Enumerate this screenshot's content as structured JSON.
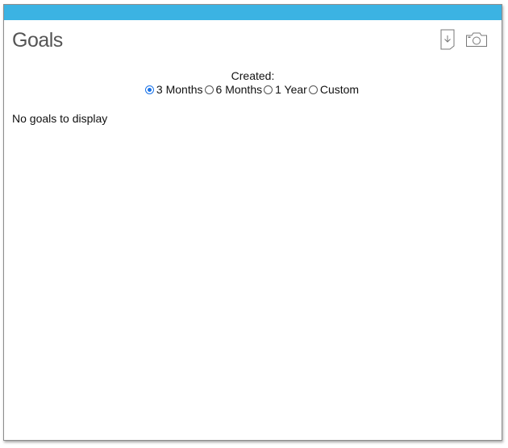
{
  "widget": {
    "title": "Goals",
    "icons": {
      "download": "download-icon",
      "camera": "camera-icon"
    },
    "colors": {
      "header_bar": "#3bb3e3",
      "radio_accent": "#1a73e8"
    }
  },
  "filter": {
    "label": "Created:",
    "options": [
      {
        "label": "3 Months",
        "selected": true
      },
      {
        "label": "6 Months",
        "selected": false
      },
      {
        "label": "1 Year",
        "selected": false
      },
      {
        "label": "Custom",
        "selected": false
      }
    ]
  },
  "content": {
    "empty_message": "No goals to display"
  }
}
